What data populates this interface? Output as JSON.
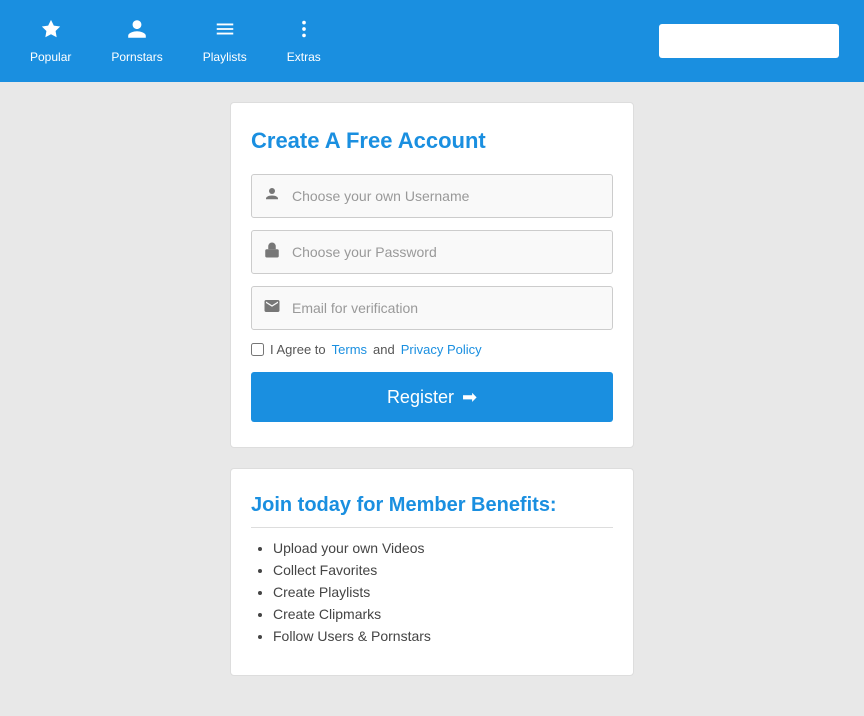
{
  "navbar": {
    "items": [
      {
        "id": "popular",
        "label": "Popular",
        "icon": "⭐"
      },
      {
        "id": "pornstars",
        "label": "Pornstars",
        "icon": "🐾"
      },
      {
        "id": "playlists",
        "label": "Playlists",
        "icon": "☰"
      },
      {
        "id": "extras",
        "label": "Extras",
        "icon": "⋮"
      }
    ],
    "search_placeholder": ""
  },
  "register_card": {
    "title": "Create A Free Account",
    "username_placeholder": "Choose your own Username",
    "password_placeholder": "Choose your Password",
    "email_placeholder": "Email for verification",
    "terms_text": "I Agree to",
    "terms_link": "Terms",
    "and_text": "and",
    "privacy_link": "Privacy Policy",
    "register_label": "Register",
    "register_arrow": "❯"
  },
  "benefits_card": {
    "title": "Join today for Member Benefits:",
    "items": [
      "Upload your own Videos",
      "Collect Favorites",
      "Create Playlists",
      "Create Clipmarks",
      "Follow Users & Pornstars"
    ]
  }
}
